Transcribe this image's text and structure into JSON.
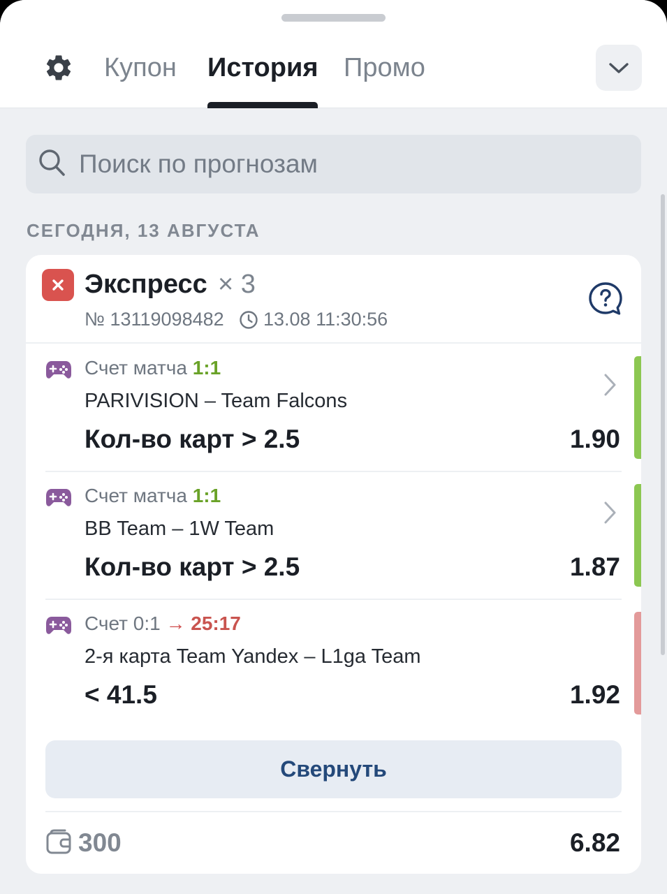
{
  "header": {
    "tabs": [
      {
        "label": "Купон",
        "active": false
      },
      {
        "label": "История",
        "active": true
      },
      {
        "label": "Промо",
        "active": false
      }
    ],
    "icons": {
      "settings": "gear-icon",
      "collapse": "chevron-down-icon"
    }
  },
  "search": {
    "placeholder": "Поиск по прогнозам",
    "icon": "search-icon"
  },
  "date_header": "СЕГОДНЯ, 13 АВГУСТА",
  "bet": {
    "status": "lost",
    "status_color": "#d9534f",
    "type": "Экспресс",
    "count": "× 3",
    "number": "№ 13119098482",
    "time": "13.08 11:30:56",
    "selections": [
      {
        "meta_label": "Счет матча",
        "score": "1:1",
        "match": "PARIVISION – Team Falcons",
        "market": "Кол-во карт > 2.5",
        "odds": "1.90",
        "result_color": "#8cc751"
      },
      {
        "meta_label": "Счет матча",
        "score": "1:1",
        "match": "BB Team – 1W Team",
        "market": "Кол-во карт > 2.5",
        "odds": "1.87",
        "result_color": "#8cc751"
      },
      {
        "meta_label": "Счет",
        "score": "0:1",
        "arrow": "→",
        "live_score": "25:17",
        "match": "2-я карта Team Yandex – L1ga Team",
        "market": "< 41.5",
        "odds": "1.92",
        "result_color": "#e39a9a"
      }
    ],
    "collapse_label": "Свернуть",
    "stake": "300",
    "total_odds": "6.82"
  }
}
